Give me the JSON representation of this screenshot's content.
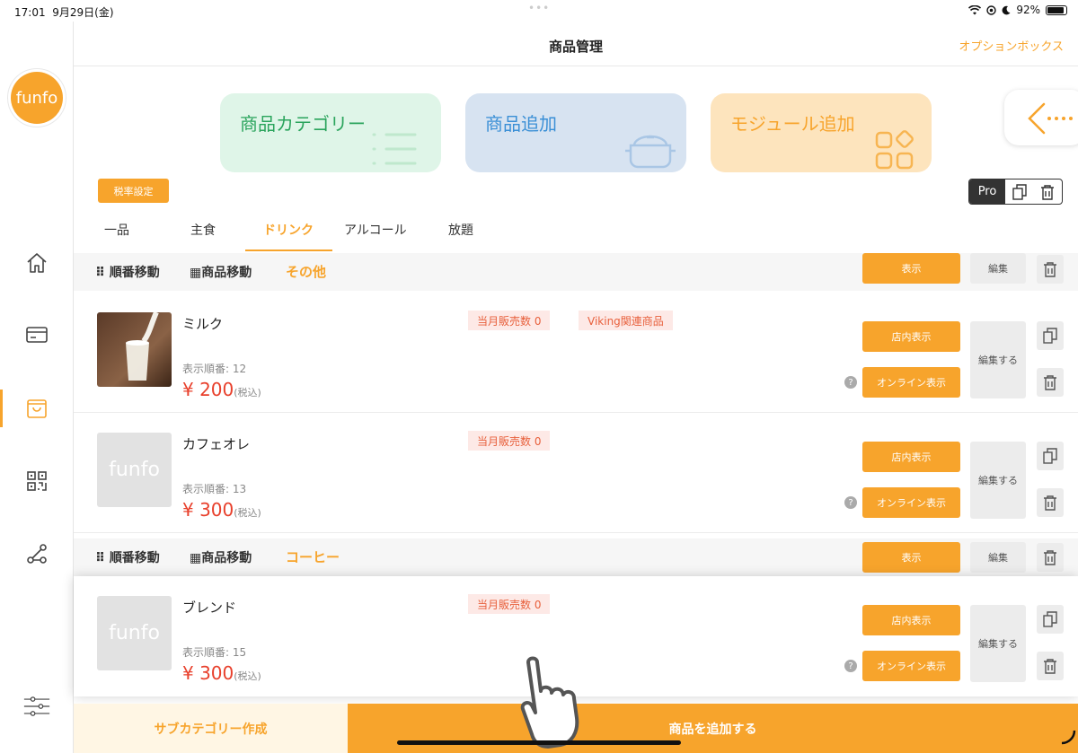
{
  "status_bar": {
    "time": "17:01",
    "date": "9月29日(金)",
    "battery": "92%"
  },
  "sidebar": {
    "logo": "funfo"
  },
  "header": {
    "title": "商品管理",
    "option_label": "オプションボックス"
  },
  "cards": {
    "category": {
      "label": "商品カテゴリー",
      "color": "#dff5e8",
      "text_color": "#2aa45c"
    },
    "add_product": {
      "label": "商品追加",
      "color": "#d7e3f1",
      "text_color": "#3a8fd6"
    },
    "add_module": {
      "label": "モジュール追加",
      "color": "#fde4bd",
      "text_color": "#f7a42c"
    }
  },
  "tax_button": "税率設定",
  "pro_label": "Pro",
  "tabs": [
    "一品",
    "主食",
    "ドリンク",
    "アルコール",
    "放題"
  ],
  "active_tab": "ドリンク",
  "categories": [
    {
      "reorder": "順番移動",
      "move": "商品移動",
      "name": "その他",
      "show": "表示",
      "edit": "編集"
    },
    {
      "reorder": "順番移動",
      "move": "商品移動",
      "name": "コーヒー",
      "show": "表示",
      "edit": "編集"
    }
  ],
  "products": [
    {
      "name": "ミルク",
      "order": "表示順番: 12",
      "price": "¥ 200",
      "tax": "(税込)",
      "sales": "当月販売数 0",
      "tag": "Viking関連商品",
      "store_btn": "店内表示",
      "online_btn": "オンライン表示",
      "edit_btn": "編集する"
    },
    {
      "name": "カフェオレ",
      "order": "表示順番: 13",
      "price": "¥ 300",
      "tax": "(税込)",
      "sales": "当月販売数 0",
      "thumb_text": "funfo",
      "store_btn": "店内表示",
      "online_btn": "オンライン表示",
      "edit_btn": "編集する"
    },
    {
      "name": "ブレンド",
      "order": "表示順番: 15",
      "price": "¥ 300",
      "tax": "(税込)",
      "sales": "当月販売数 0",
      "thumb_text": "funfo",
      "store_btn": "店内表示",
      "online_btn": "オンライン表示",
      "edit_btn": "編集する"
    }
  ],
  "bottom": {
    "sub_category": "サブカテゴリー作成",
    "add_product": "商品を追加する"
  },
  "accent_color": "#f7a42c"
}
